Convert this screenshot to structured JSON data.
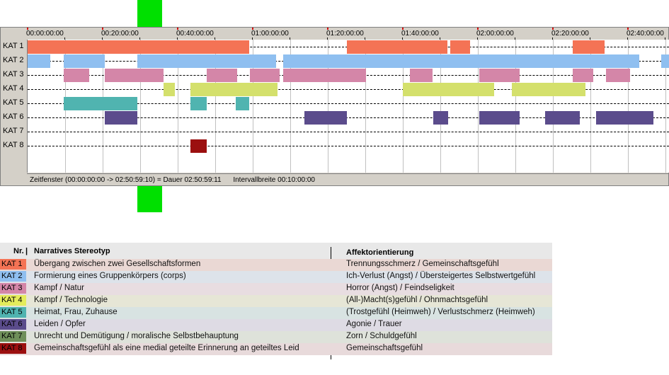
{
  "timeline": {
    "total_seconds": 10259,
    "ticks": [
      "00:00:00:00",
      "00:20:00:00",
      "00:40:00:00",
      "01:00:00:00",
      "01:20:00:00",
      "01:40:00:00",
      "02:00:00:00",
      "02:20:00:00",
      "02:40:00:00"
    ],
    "tick_seconds": [
      0,
      1200,
      2400,
      3600,
      4800,
      6000,
      7200,
      8400,
      9600
    ],
    "status": {
      "window": "Zeitfenster (00:00:00:00 -> 02:50:59:10) = Dauer 02:50:59:11",
      "interval": "Intervallbreite 00:10:00:00"
    },
    "categories": [
      {
        "label": "KAT 1",
        "color": "#f47355",
        "segments": [
          [
            0,
            3540
          ],
          [
            5110,
            6710
          ],
          [
            6760,
            7080
          ],
          [
            8720,
            9230
          ]
        ]
      },
      {
        "label": "KAT 2",
        "color": "#8fbff0",
        "segments": [
          [
            0,
            360
          ],
          [
            580,
            1230
          ],
          [
            1760,
            3970
          ],
          [
            4090,
            9780
          ],
          [
            10140,
            10259
          ]
        ]
      },
      {
        "label": "KAT 3",
        "color": "#d486a8",
        "segments": [
          [
            580,
            980
          ],
          [
            1230,
            2170
          ],
          [
            2860,
            3350
          ],
          [
            3560,
            4030
          ],
          [
            4090,
            5410
          ],
          [
            6110,
            6480
          ],
          [
            7220,
            7870
          ],
          [
            8720,
            9050
          ],
          [
            9250,
            9640
          ]
        ]
      },
      {
        "label": "KAT 4",
        "color": "#d4e06c",
        "segments": [
          [
            2170,
            2360
          ],
          [
            2600,
            4000
          ],
          [
            6000,
            7460
          ],
          [
            7750,
            8920
          ]
        ]
      },
      {
        "label": "KAT 5",
        "color": "#50b4b0",
        "segments": [
          [
            580,
            1760
          ],
          [
            2600,
            2870
          ],
          [
            3330,
            3540
          ]
        ]
      },
      {
        "label": "KAT 6",
        "color": "#5b4c8c",
        "segments": [
          [
            1230,
            1760
          ],
          [
            4430,
            5110
          ],
          [
            6490,
            6730
          ],
          [
            7220,
            7870
          ],
          [
            8280,
            8830
          ],
          [
            9090,
            10010
          ]
        ]
      },
      {
        "label": "KAT 7",
        "color": "#6f8f5a",
        "segments": []
      },
      {
        "label": "KAT 8",
        "color": "#9b0f0f",
        "segments": [
          [
            2600,
            2870
          ]
        ]
      }
    ]
  },
  "legend": {
    "headers": {
      "nr": "Nr.",
      "stereotype": "Narratives Stereotyp",
      "affect": "Affektorientierung"
    },
    "rows": [
      {
        "code": "KAT 1",
        "color": "#f47355",
        "bg": "#ead8d4",
        "stereotype": "Übergang zwischen zwei Gesellschaftsformen",
        "affect": "Trennungsschmerz / Gemeinschaftsgefühl"
      },
      {
        "code": "KAT 2",
        "color": "#8fbff0",
        "bg": "#dde3ea",
        "stereotype": "Formierung eines Gruppenkörpers (corps)",
        "affect": "Ich-Verlust (Angst) / Übersteigertes Selbstwertgefühl"
      },
      {
        "code": "KAT 3",
        "color": "#d486a8",
        "bg": "#e8dde1",
        "stereotype": "Kampf / Natur",
        "affect": "Horror (Angst) / Feindseligkeit"
      },
      {
        "code": "KAT 4",
        "color": "#e4ec5c",
        "bg": "#e6e6d6",
        "stereotype": "Kampf / Technologie",
        "affect": "(All-)Macht(s)gefühl / Ohnmachtsgefühl"
      },
      {
        "code": "KAT 5",
        "color": "#50b4b0",
        "bg": "#d8e3e2",
        "stereotype": "Heimat, Frau, Zuhause",
        "affect": "(Trostgefühl (Heimweh) / Verlustschmerz (Heimweh)"
      },
      {
        "code": "KAT 6",
        "color": "#5b4c8c",
        "bg": "#dedbe4",
        "stereotype": "Leiden / Opfer",
        "affect": "Agonie / Trauer"
      },
      {
        "code": "KAT 7",
        "color": "#6f8f5a",
        "bg": "#dee2da",
        "stereotype": "Unrecht und Demütigung / moralische Selbstbehauptung",
        "affect": "Zorn / Schuldgefühl"
      },
      {
        "code": "KAT 8",
        "color": "#9b0f0f",
        "bg": "#e8dadb",
        "stereotype": "Gemeinschaftsgefühl als eine medial geteilte Erinnerung an geteiltes Leid",
        "affect": "Gemeinschaftsgefühl"
      }
    ]
  }
}
